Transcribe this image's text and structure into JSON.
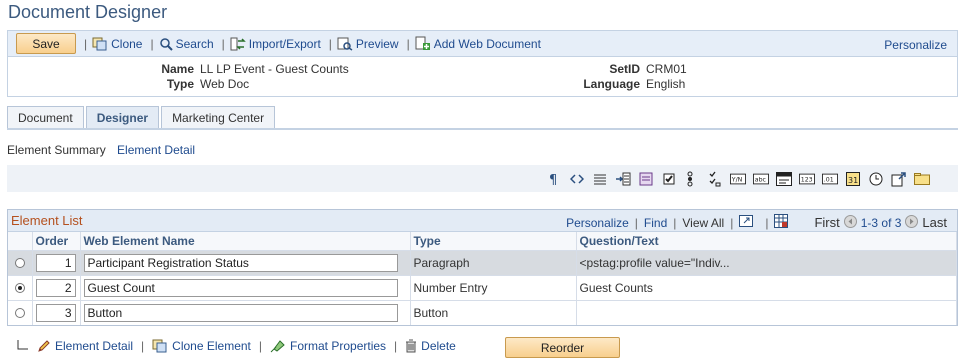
{
  "page": {
    "title": "Document Designer"
  },
  "toolbar": {
    "save_label": "Save",
    "items": [
      {
        "label": "Clone",
        "icon": "clone-icon"
      },
      {
        "label": "Search",
        "icon": "search-icon"
      },
      {
        "label": "Import/Export",
        "icon": "import-export-icon"
      },
      {
        "label": "Preview",
        "icon": "preview-icon"
      },
      {
        "label": "Add Web Document",
        "icon": "add-document-icon"
      }
    ],
    "personalize_label": "Personalize"
  },
  "header": {
    "name_label": "Name",
    "name_value": "LL LP Event - Guest Counts",
    "type_label": "Type",
    "type_value": "Web Doc",
    "setid_label": "SetID",
    "setid_value": "CRM01",
    "language_label": "Language",
    "language_value": "English"
  },
  "tabs": [
    {
      "label": "Document",
      "active": false
    },
    {
      "label": "Designer",
      "active": true
    },
    {
      "label": "Marketing Center",
      "active": false
    }
  ],
  "summary": {
    "label": "Element Summary",
    "detail_link": "Element Detail"
  },
  "grid": {
    "title": "Element List",
    "personalize": "Personalize",
    "find": "Find",
    "view_all": "View All",
    "first": "First",
    "range": "1-3 of 3",
    "last": "Last",
    "columns": {
      "order": "Order",
      "name": "Web Element Name",
      "type": "Type",
      "question": "Question/Text"
    },
    "rows": [
      {
        "order": "1",
        "name": "Participant Registration Status",
        "type": "Paragraph",
        "question": "<pstag:profile value=\"Indiv...",
        "selected": false,
        "highlight": true
      },
      {
        "order": "2",
        "name": "Guest Count",
        "type": "Number Entry",
        "question": "Guest Counts",
        "selected": true,
        "highlight": false
      },
      {
        "order": "3",
        "name": "Button",
        "type": "Button",
        "question": "",
        "selected": false,
        "highlight": false
      }
    ]
  },
  "bottom": {
    "element_detail": "Element Detail",
    "clone_element": "Clone Element",
    "format_properties": "Format Properties",
    "delete": "Delete",
    "reorder": "Reorder"
  }
}
